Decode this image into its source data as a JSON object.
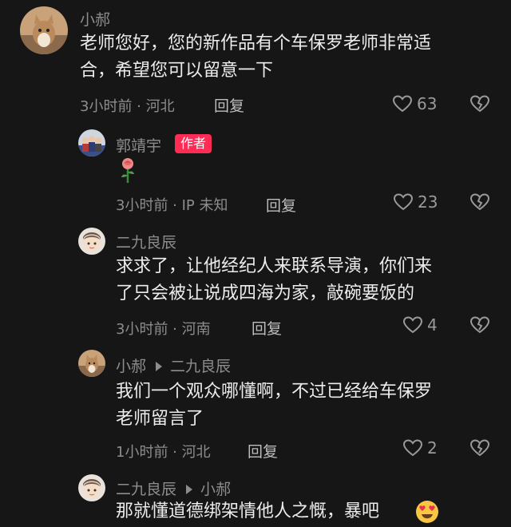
{
  "comments": [
    {
      "author": "小郝",
      "lines": [
        "老师您好，您的新作品有个车保罗老师非常适",
        "合，希望您可以留意一下"
      ],
      "time": "3小时前",
      "location": "河北",
      "reply_label": "回复",
      "likes": "63"
    },
    {
      "author": "郭靖宇",
      "badge": "作者",
      "emoji": "rose",
      "time": "3小时前",
      "location": "IP 未知",
      "reply_label": "回复",
      "likes": "23"
    },
    {
      "author": "二九良辰",
      "lines": [
        "求求了，让他经纪人来联系导演，你们来",
        "了只会被让说成四海为家，敲碗要饭的"
      ],
      "time": "3小时前",
      "location": "河南",
      "reply_label": "回复",
      "likes": "4"
    },
    {
      "author": "小郝",
      "reply_to": "二九良辰",
      "lines": [
        "我们一个观众哪懂啊，不过已经给车保罗",
        "老师留言了"
      ],
      "time": "1小时前",
      "location": "河北",
      "reply_label": "回复",
      "likes": "2"
    },
    {
      "author": "二九良辰",
      "reply_to": "小郝",
      "partial_line": "那就懂道德绑架情他人之慨，暴吧"
    }
  ],
  "colors": {
    "background": "#161616",
    "badge": "#fe2c55",
    "meta": "#8d8d8d"
  },
  "icons": [
    "heart-outline-icon",
    "broken-heart-icon",
    "rose-emoji",
    "heart-eyes-emoji"
  ]
}
